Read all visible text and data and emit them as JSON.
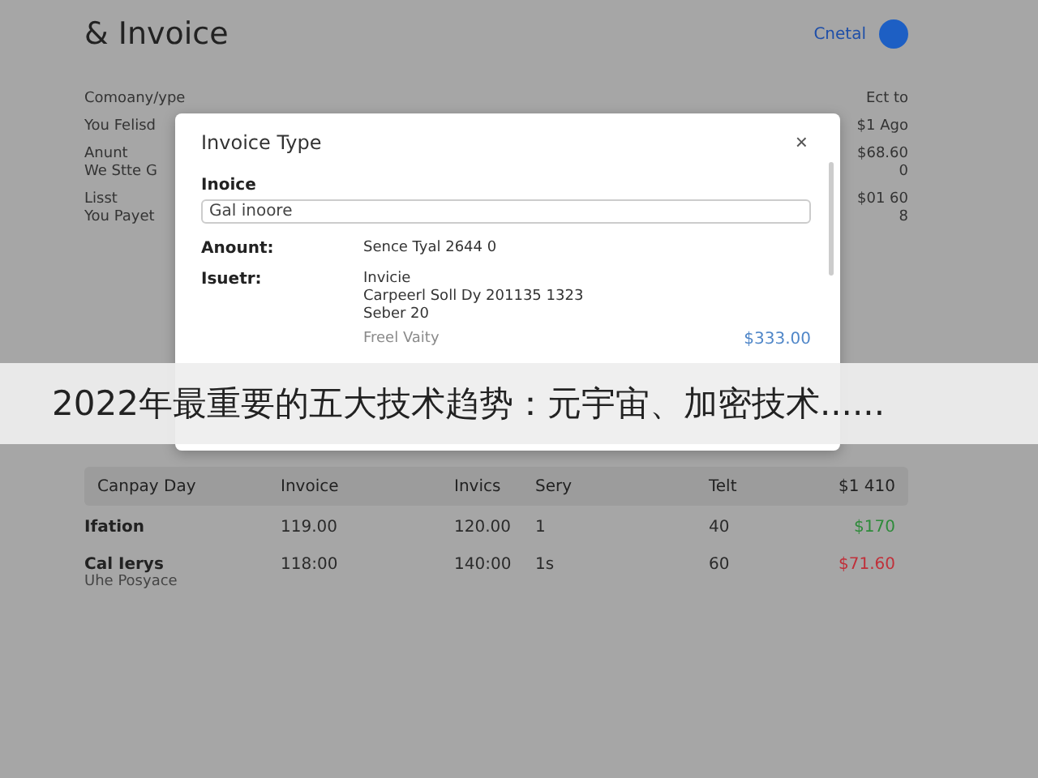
{
  "header": {
    "title": "& Invoice",
    "link": "Cnetal"
  },
  "summary": [
    {
      "label": "Comoany/ype",
      "value": "Ect to"
    },
    {
      "label": "You Felisd",
      "value": "$1 Ago"
    },
    {
      "label": "Anunt",
      "sub": "We Stte G",
      "value": "$68.60",
      "sub_value": "0"
    },
    {
      "label": "Lisst",
      "sub": "You Payet",
      "value": "$01 60",
      "sub_value": "8"
    }
  ],
  "table": {
    "columns": [
      "Canpay Day",
      "Invoice",
      "Invics",
      "Sery",
      "Telt",
      "$1 410"
    ],
    "rows": [
      {
        "cells": [
          "Ifation",
          "119.00",
          "120.00",
          "1",
          "40",
          "$170"
        ],
        "color": "#2e8b3a"
      },
      {
        "cells": [
          "Cal Ierys",
          "118:00",
          "140:00",
          "1s",
          "60",
          "$71.60"
        ],
        "sub": "Uhe Posyace",
        "color": "#c0303a"
      }
    ]
  },
  "dialog": {
    "title": "Invoice Type",
    "close": "×",
    "field_label": "Inoice",
    "field_value": "Gal inoore",
    "details": [
      {
        "label": "Anount:",
        "lines": [
          "Sence Tyal 2644 0"
        ]
      },
      {
        "label": "Isuetr:",
        "lines": [
          "Invicie",
          "Carpeerl Soll Dy 201135 1323",
          "Seber 20"
        ]
      }
    ],
    "faded_row": {
      "label": "Freel Vaity",
      "value": "$333.00"
    }
  },
  "banner": {
    "text": "2022年最重要的五大技术趋势：元宇宙、加密技术......"
  }
}
